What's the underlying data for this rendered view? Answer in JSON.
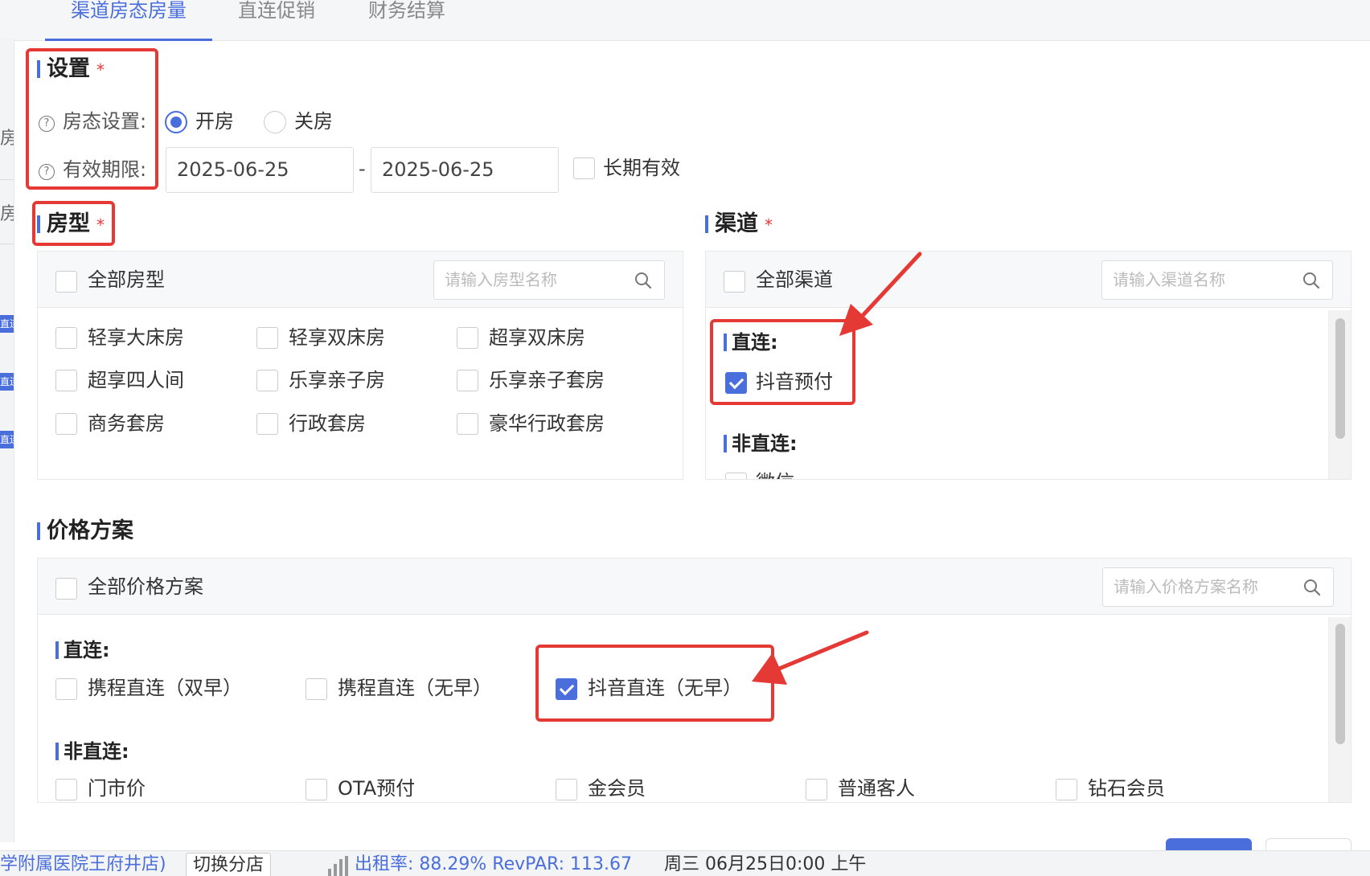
{
  "tabs": [
    {
      "label": "渠道房态房量",
      "active": true
    },
    {
      "label": "直连促销",
      "active": false
    },
    {
      "label": "财务结算",
      "active": false
    }
  ],
  "left_strip": {
    "cut_1": "房型",
    "cut_2": "房数",
    "tag_text": "直连"
  },
  "settings": {
    "title": "设置",
    "required_mark": "*",
    "help_glyph": "?",
    "room_status_label": "房态设置:",
    "room_status_options": [
      {
        "label": "开房",
        "checked": true
      },
      {
        "label": "关房",
        "checked": false
      }
    ],
    "validity_label": "有效期限:",
    "start_date": "2025-06-25",
    "date_separator": "-",
    "end_date": "2025-06-25",
    "long_term_label": "长期有效",
    "long_term_checked": false
  },
  "room_types": {
    "title": "房型",
    "required_mark": "*",
    "all_label": "全部房型",
    "search_placeholder": "请输入房型名称",
    "items": [
      {
        "label": "轻享大床房",
        "checked": false
      },
      {
        "label": "轻享双床房",
        "checked": false
      },
      {
        "label": "超享双床房",
        "checked": false
      },
      {
        "label": "超享四人间",
        "checked": false
      },
      {
        "label": "乐享亲子房",
        "checked": false
      },
      {
        "label": "乐享亲子套房",
        "checked": false
      },
      {
        "label": "商务套房",
        "checked": false
      },
      {
        "label": "行政套房",
        "checked": false
      },
      {
        "label": "豪华行政套房",
        "checked": false
      }
    ]
  },
  "channels": {
    "title": "渠道",
    "required_mark": "*",
    "all_label": "全部渠道",
    "search_placeholder": "请输入渠道名称",
    "direct_title": "直连:",
    "direct_items": [
      {
        "label": "抖音预付",
        "checked": true
      }
    ],
    "indirect_title": "非直连:",
    "indirect_items": [
      {
        "label": "微信",
        "checked": false
      }
    ]
  },
  "price_plans": {
    "title": "价格方案",
    "all_label": "全部价格方案",
    "search_placeholder": "请输入价格方案名称",
    "direct_title": "直连:",
    "direct_items": [
      {
        "label": "携程直连（双早）",
        "checked": false
      },
      {
        "label": "携程直连（无早）",
        "checked": false
      },
      {
        "label": "抖音直连（无早）",
        "checked": true
      }
    ],
    "indirect_title": "非直连:",
    "indirect_items": [
      {
        "label": "门市价",
        "checked": false
      },
      {
        "label": "OTA预付",
        "checked": false
      },
      {
        "label": "金会员",
        "checked": false
      },
      {
        "label": "普通客人",
        "checked": false
      },
      {
        "label": "钻石会员",
        "checked": false
      }
    ]
  },
  "status_bar": {
    "hotel_name": "学附属医院王府井店)",
    "switch_store": "切换分店",
    "occupancy": "出租率: 88.29% RevPAR: 113.67",
    "datetime": "周三 06月25日0:00 上午"
  },
  "colors": {
    "accent": "#4a6fdc",
    "annotation_red": "#e53935"
  }
}
